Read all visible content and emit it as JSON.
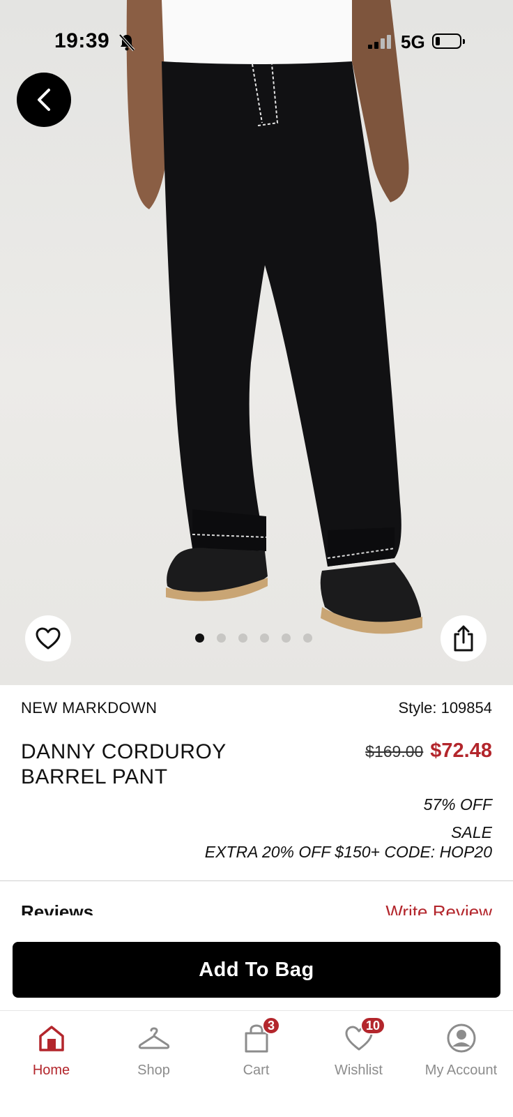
{
  "status_bar": {
    "time": "19:39",
    "network": "5G"
  },
  "hero": {
    "carousel": {
      "count": 6,
      "active_index": 0
    }
  },
  "product": {
    "tag": "NEW MARKDOWN",
    "style": "Style: 109854",
    "name_line1": "DANNY CORDUROY",
    "name_line2": "BARREL PANT",
    "original_price": "$169.00",
    "sale_price": "$72.48",
    "discount": "57% OFF",
    "sale_label": "SALE",
    "promo": "EXTRA 20% OFF $150+ CODE: HOP20"
  },
  "reviews": {
    "title": "Reviews",
    "write_label": "Write Review"
  },
  "add_to_bag": "Add To Bag",
  "tabs": [
    {
      "label": "Home",
      "icon": "home-icon",
      "active": true
    },
    {
      "label": "Shop",
      "icon": "hanger-icon"
    },
    {
      "label": "Cart",
      "icon": "bag-icon",
      "badge": "3"
    },
    {
      "label": "Wishlist",
      "icon": "heart-icon",
      "badge": "10"
    },
    {
      "label": "My Account",
      "icon": "account-icon"
    }
  ],
  "colors": {
    "accent": "#b3262c",
    "button": "#000000"
  }
}
